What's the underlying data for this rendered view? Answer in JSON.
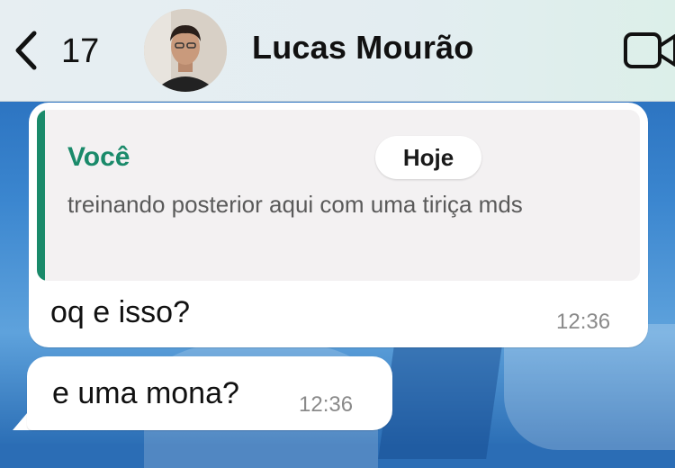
{
  "header": {
    "back_count": "17",
    "contact_name": "Lucas Mourão",
    "back_icon": "chevron-left-icon",
    "video_icon": "video-camera-icon"
  },
  "messages": [
    {
      "quote": {
        "author": "Você",
        "text": "treinando posterior aqui com uma tiriça mds"
      },
      "date_label": "Hoje",
      "text": "oq e isso?",
      "time": "12:36"
    },
    {
      "text": "e uma mona?",
      "time": "12:36"
    }
  ],
  "colors": {
    "accent_green": "#1a8a6a",
    "bubble": "#ffffff",
    "wallpaper": "#2b6db5"
  }
}
